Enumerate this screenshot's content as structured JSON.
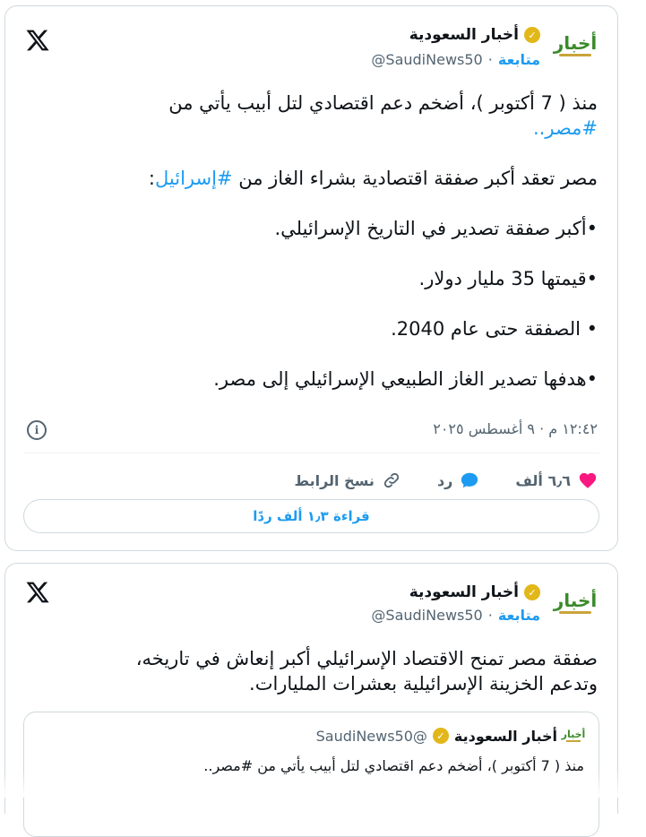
{
  "tweet1": {
    "author_name": "أخبار السعودية",
    "handle": "@SaudiNews50",
    "separator": "·",
    "follow_label": "متابعة",
    "avatar_text": "أخبار",
    "text_lines": [
      "منذ ( 7 أكتوبر )، أضخم دعم اقتصادي لتل أبيب يأتي من",
      "#مصر..",
      "",
      "مصر تعقد أكبر صفقة اقتصادية بشراء الغاز من #إسرائيل:",
      "",
      "•أكبر صفقة تصدير في التاريخ الإسرائيلي.",
      "",
      "•قيمتها 35 مليار دولار.",
      "",
      "• الصفقة حتى عام 2040.",
      "",
      "•هدفها تصدير الغاز الطبيعي الإسرائيلي إلى مصر."
    ],
    "timestamp": "١٢:٤٢ م · ٩ أغسطس ٢٠٢٥",
    "likes_count": "٦٫٦ ألف",
    "reply_label": "رد",
    "copy_link_label": "نسخ الرابط",
    "read_replies_label": "قراءة ١٫٣ ألف ردًا"
  },
  "tweet2": {
    "author_name": "أخبار السعودية",
    "handle": "@SaudiNews50",
    "separator": "·",
    "follow_label": "متابعة",
    "avatar_text": "أخبار",
    "text_lines": [
      "صفقة مصر تمنح الاقتصاد الإسرائيلي أكبر إنعاش في تاريخه،",
      "وتدعم الخزينة الإسرائيلية بعشرات المليارات."
    ],
    "quote": {
      "author_name": "أخبار السعودية",
      "handle": "@SaudiNews50",
      "avatar_text": "أخبار",
      "text": "منذ ( 7 أكتوبر )، أضخم دعم اقتصادي لتل أبيب يأتي من #مصر.."
    }
  },
  "colors": {
    "accent": "#1d9bf0",
    "like": "#f91880",
    "verified": "#e2b719",
    "muted": "#536471"
  }
}
